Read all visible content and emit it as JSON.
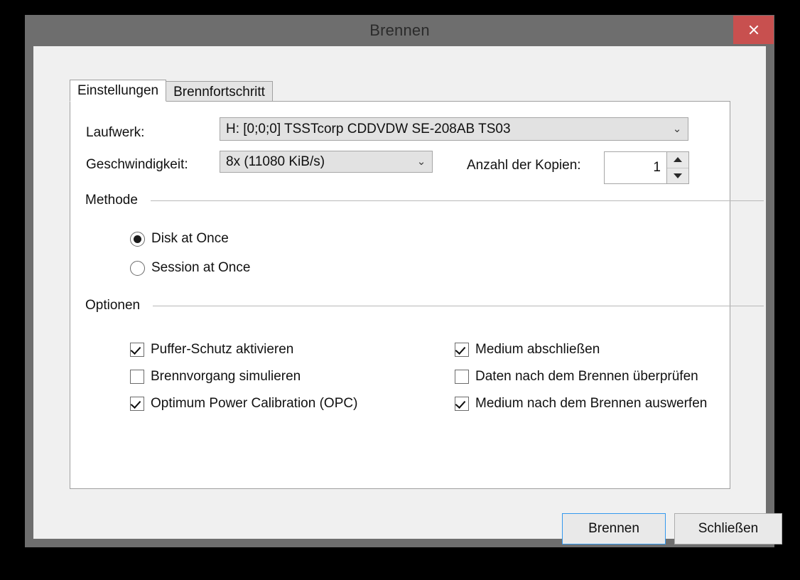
{
  "window": {
    "title": "Brennen",
    "close_label": "×",
    "title_color": "#6e6e6e",
    "close_color": "#c8504f"
  },
  "tabs": [
    {
      "label": "Einstellungen",
      "active": true
    },
    {
      "label": "Brennfortschritt",
      "active": false
    }
  ],
  "form": {
    "drive_label": "Laufwerk:",
    "drive_value": "H:  [0;0;0] TSSTcorp CDDVDW SE-208AB TS03",
    "speed_label": "Geschwindigkeit:",
    "speed_value": "8x (11080 KiB/s)",
    "copies_label": "Anzahl der Kopien:",
    "copies_value": "1",
    "chevron": "⌄"
  },
  "method": {
    "header": "Methode",
    "options": [
      {
        "label": "Disk at Once",
        "checked": true
      },
      {
        "label": "Session at Once",
        "checked": false
      }
    ]
  },
  "options": {
    "header": "Optionen",
    "left": [
      {
        "label": "Puffer-Schutz aktivieren",
        "checked": true
      },
      {
        "label": "Brennvorgang simulieren",
        "checked": false
      },
      {
        "label": "Optimum Power Calibration (OPC)",
        "checked": true
      }
    ],
    "right": [
      {
        "label": "Medium abschließen",
        "checked": true
      },
      {
        "label": "Daten nach dem Brennen überprüfen",
        "checked": false
      },
      {
        "label": "Medium nach dem Brennen auswerfen",
        "checked": true
      }
    ]
  },
  "footer": {
    "burn_label": "Brennen",
    "close_label": "Schließen",
    "focus_color": "#3399ee"
  }
}
